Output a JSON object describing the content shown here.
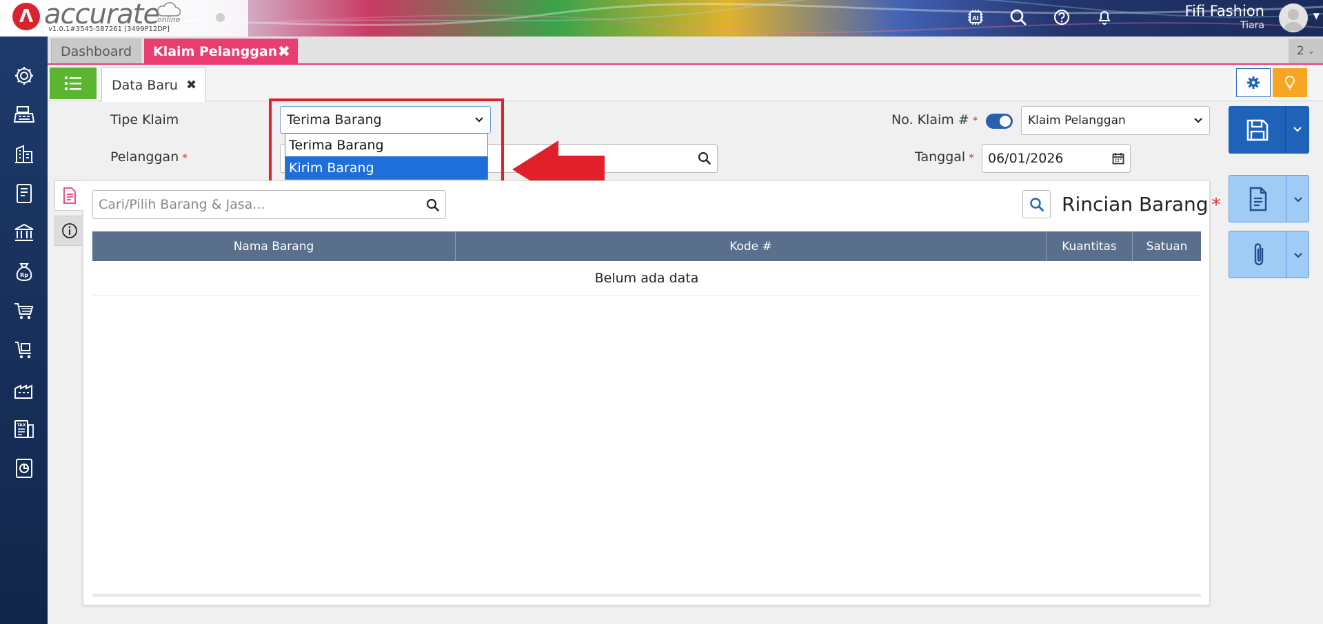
{
  "header": {
    "logo_text": "accurate",
    "logo_sub": "online",
    "version": "v1.0.1#3545-587261 [3499P12DP]",
    "company": "Fifi Fashion",
    "user": "Tiara"
  },
  "tabs": {
    "dashboard": "Dashboard",
    "active": "Klaim Pelanggan",
    "counter": "2"
  },
  "inner_tab": {
    "label": "Data Baru"
  },
  "form": {
    "tipe_klaim_label": "Tipe Klaim",
    "tipe_klaim_value": "Terima Barang",
    "tipe_klaim_options": [
      "Terima Barang",
      "Kirim Barang"
    ],
    "tipe_klaim_highlighted": "Kirim Barang",
    "pelanggan_label": "Pelanggan",
    "no_klaim_label": "No. Klaim #",
    "no_klaim_value": "Klaim Pelanggan",
    "tanggal_label": "Tanggal",
    "tanggal_value": "06/01/2026",
    "required_mark": "*"
  },
  "detail": {
    "search_placeholder": "Cari/Pilih Barang & Jasa...",
    "title": "Rincian Barang",
    "columns": [
      "Nama Barang",
      "Kode #",
      "Kuantitas",
      "Satuan"
    ],
    "empty_text": "Belum ada data"
  },
  "colors": {
    "accent_tab": "#e83e72",
    "primary_blue": "#1f63b8",
    "sidebar": "#1d3a6b",
    "list_green": "#5cb531",
    "highlight": "#e0202a"
  }
}
